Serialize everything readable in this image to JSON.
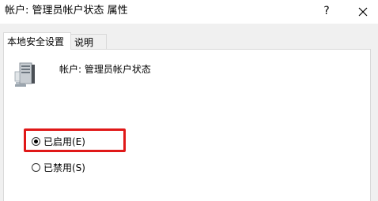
{
  "window": {
    "title": "帐户: 管理员帐户状态 属性",
    "help_label": "?",
    "close_icon": "close-icon"
  },
  "tabs": [
    {
      "label": "本地安全设置",
      "selected": true
    },
    {
      "label": "说明",
      "selected": false
    }
  ],
  "policy": {
    "icon": "server-icon",
    "name": "帐户: 管理员帐户状态"
  },
  "options": {
    "enabled_label": "已启用(E)",
    "disabled_label": "已禁用(S)",
    "selected": "enabled"
  },
  "highlight_color": "#e01818"
}
